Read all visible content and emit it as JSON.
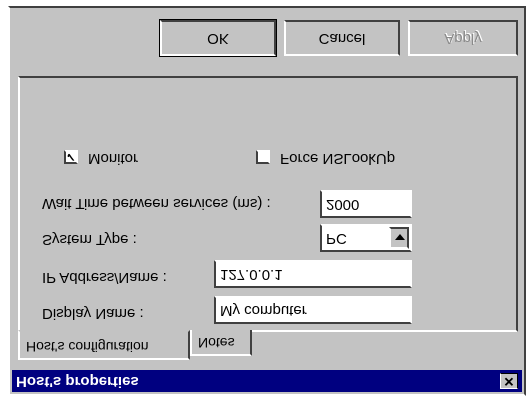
{
  "window": {
    "title": "Host's properties",
    "close_glyph": "✕"
  },
  "tabs": [
    {
      "label": "Host's configuration"
    },
    {
      "label": "Notes"
    }
  ],
  "form": {
    "display_name_label": "Display Name :",
    "display_name_value": "My computer",
    "ip_label": "IP Address/Name :",
    "ip_value": "127.0.0.1",
    "system_type_label": "System Type :",
    "system_type_value": "PC",
    "wait_time_label": "Wait Time between services (ms) :",
    "wait_time_value": "2000",
    "monitor_label": "Monitor",
    "monitor_checked": true,
    "monitor_glyph": "✓",
    "force_nslookup_label": "Force NSLookUp",
    "force_nslookup_checked": false
  },
  "buttons": {
    "ok": "OK",
    "cancel": "Cancel",
    "apply": "Apply"
  },
  "colors": {
    "face": "#c3c3c3",
    "titlebar": "#000080",
    "titlebar_text": "#ffffff"
  },
  "icons": {
    "close": "close-icon",
    "combo_arrow": "chevron-down-icon",
    "check": "check-icon"
  }
}
